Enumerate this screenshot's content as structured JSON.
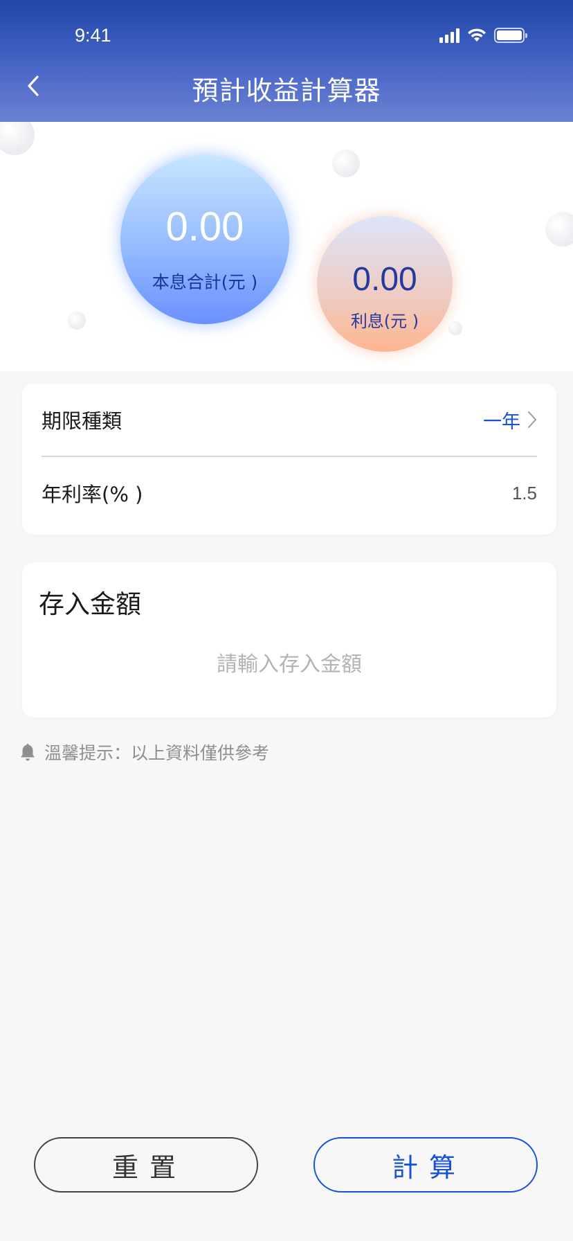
{
  "status_bar": {
    "time": "9:41"
  },
  "header": {
    "title": "預計收益計算器"
  },
  "summary": {
    "total_value": "0.00",
    "total_label": "本息合計(元 )",
    "interest_value": "0.00",
    "interest_label": "利息(元 )"
  },
  "term_card": {
    "term_label": "期限種類",
    "term_value": "一年",
    "rate_label": "年利率(% )",
    "rate_value": "1.5"
  },
  "deposit_card": {
    "title": "存入金額",
    "placeholder": "請輸入存入金額"
  },
  "tip": {
    "text": "溫馨提示：以上資料僅供參考"
  },
  "actions": {
    "reset_label": "重置",
    "calculate_label": "計算"
  },
  "colors": {
    "header_top": "#1f46a8",
    "header_bottom": "#6c82d1",
    "accent_blue": "#1550d6",
    "total_circle": "#90b6ff",
    "interest_circle": "#ffb590"
  }
}
